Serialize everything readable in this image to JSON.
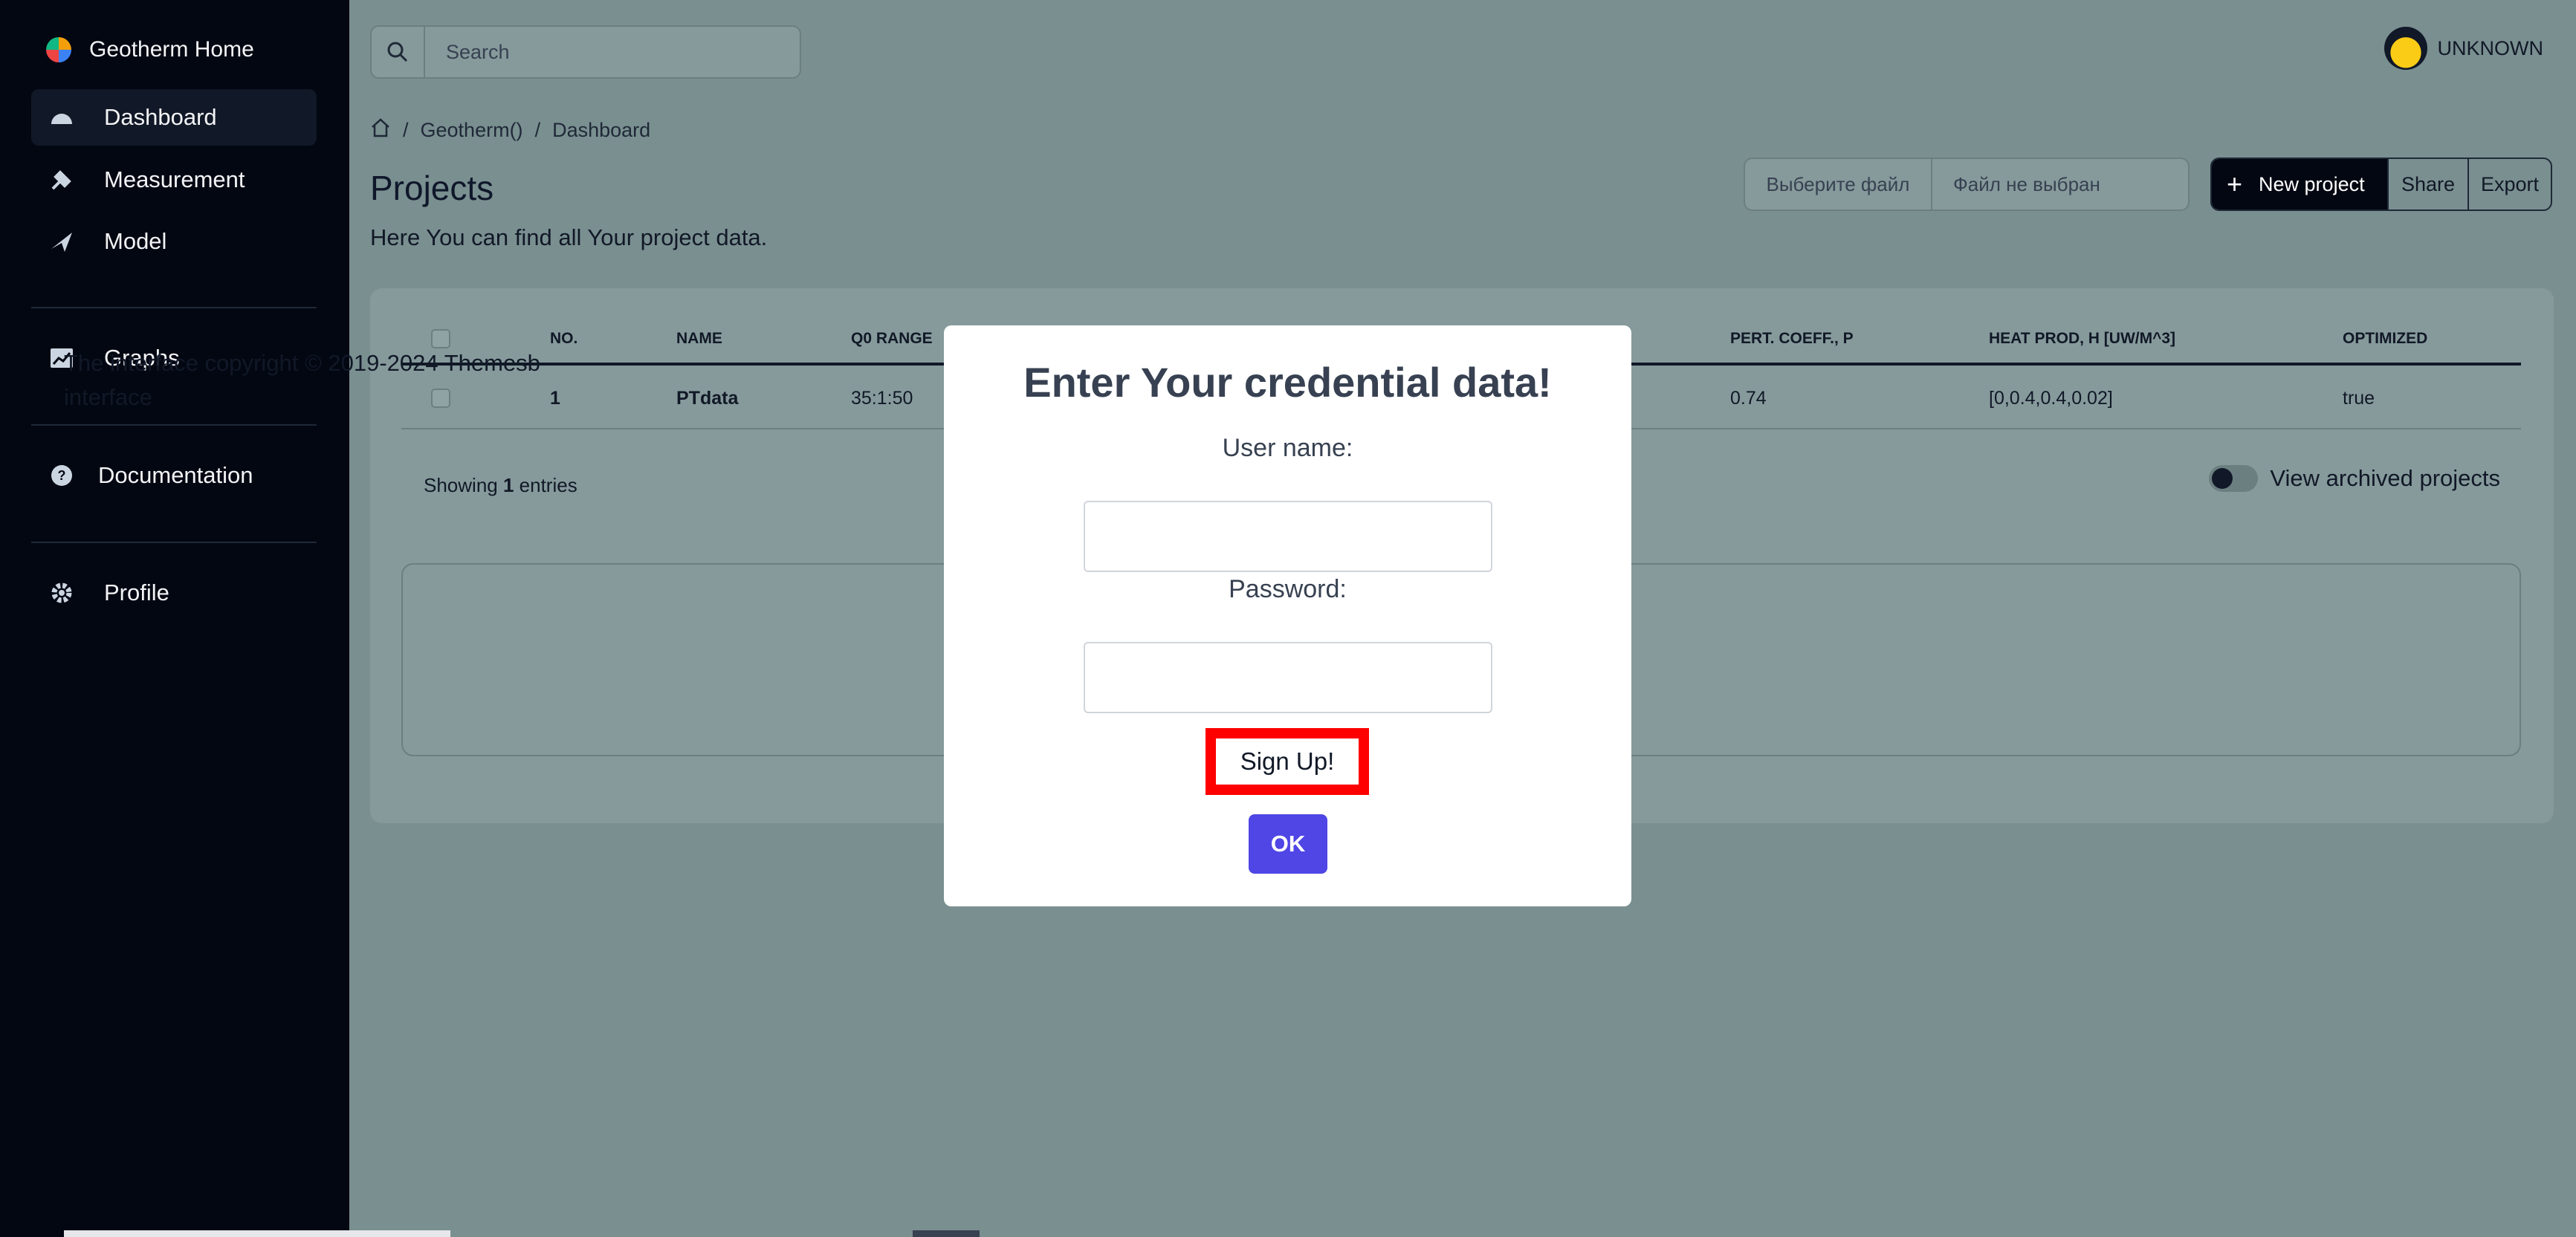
{
  "sidebar": {
    "brand": "Geotherm Home",
    "items": [
      {
        "label": "Dashboard",
        "icon": "dashboard-icon"
      },
      {
        "label": "Measurement",
        "icon": "measurement-icon"
      },
      {
        "label": "Model",
        "icon": "model-icon"
      },
      {
        "label": "Graphs",
        "icon": "graphs-icon"
      },
      {
        "label": "Documentation",
        "icon": "documentation-icon"
      },
      {
        "label": "Profile",
        "icon": "gear-icon"
      }
    ]
  },
  "header": {
    "search_placeholder": "Search",
    "user_name": "UNKNOWN"
  },
  "breadcrumb": [
    "Geotherm()",
    "Dashboard"
  ],
  "page": {
    "title": "Projects",
    "subtitle": "Here You can find all Your project data."
  },
  "file_input": {
    "choose_label": "Выберите файл",
    "none_label": "Файл не выбран"
  },
  "actions": {
    "new_project": "New project",
    "share": "Share",
    "export": "Export"
  },
  "table": {
    "columns": [
      "NO.",
      "NAME",
      "Q0 RANGE",
      "PERT. COEFF., P",
      "HEAT PROD, H [UW/M^3]",
      "OPTIMIZED"
    ],
    "rows": [
      {
        "no": "1",
        "name": "PTdata",
        "q0": "35:1:50",
        "pert": "0.74",
        "heat": "[0,0.4,0.4,0.02]",
        "optimized": "true"
      }
    ],
    "showing_prefix": "Showing ",
    "showing_count": "1",
    "showing_suffix": " entries",
    "archived_label": "View archived projects"
  },
  "footer": {
    "text": "The interface copyright © 2019-2024 Themesb",
    "text2": "interface"
  },
  "modal": {
    "title": "Enter Your credential data!",
    "username_label": "User name:",
    "password_label": "Password:",
    "signup_label": "Sign Up!",
    "ok_label": "OK"
  }
}
